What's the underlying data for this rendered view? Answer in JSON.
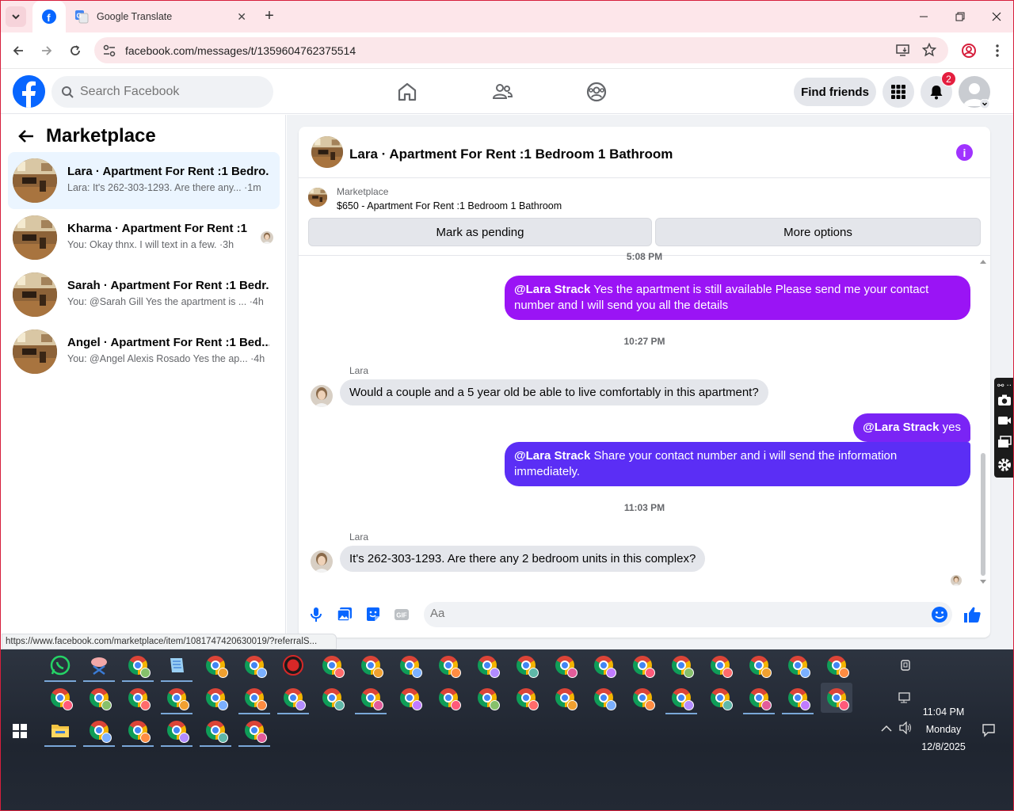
{
  "browser": {
    "tabs": [
      {
        "title": "",
        "icon": "facebook-icon",
        "active": true
      },
      {
        "title": "Google Translate",
        "icon": "google-translate-icon",
        "active": false
      }
    ],
    "url": "facebook.com/messages/t/1359604762375514",
    "status_url": "https://www.facebook.com/marketplace/item/1081747420630019/?referralS..."
  },
  "fb": {
    "search_placeholder": "Search Facebook",
    "find_friends": "Find friends",
    "notification_count": "2"
  },
  "sidebar": {
    "title": "Marketplace",
    "conversations": [
      {
        "name": "Lara · Apartment For Rent :1 Bedro...",
        "preview": "Lara: It's 262-303-1293. Are there any... ·1m",
        "selected": true
      },
      {
        "name": "Kharma · Apartment For Rent :1 ...",
        "preview": "You: Okay thnx. I will text in a few. ·3h",
        "selected": false
      },
      {
        "name": "Sarah · Apartment For Rent :1 Bedr...",
        "preview": "You: @Sarah Gill Yes the apartment is ... ·4h",
        "selected": false
      },
      {
        "name": "Angel · Apartment For Rent :1 Bed...",
        "preview": "You: @Angel Alexis Rosado Yes the ap... ·4h",
        "selected": false
      }
    ]
  },
  "chat": {
    "title": "Lara · Apartment For Rent :1 Bedroom 1 Bathroom",
    "marketplace_label": "Marketplace",
    "listing": "$650 - Apartment For Rent :1 Bedroom 1 Bathroom",
    "mark_pending": "Mark as pending",
    "more_options": "More options",
    "partial_time": "5:08 PM",
    "messages": [
      {
        "mention": "@Lara Strack",
        "text": " Yes the apartment is still available Please send me your contact number and I will send you all the details"
      },
      {
        "time": "10:27 PM"
      },
      {
        "sender": "Lara",
        "text": "Would a couple and a 5 year old be able to live comfortably in this apartment?"
      },
      {
        "mention": "@Lara Strack",
        "text": " yes"
      },
      {
        "mention": "@Lara Strack",
        "text": " Share your contact number and i will send the information immediately."
      },
      {
        "time": "11:03 PM"
      },
      {
        "sender": "Lara",
        "text": "It's 262-303-1293. Are there any 2 bedroom units in this complex?"
      }
    ],
    "composer_placeholder": "Aa",
    "colors": {
      "out_purple": "#9a14f5",
      "out_violet": "#7a24f5",
      "out_blue": "#5b2ef5",
      "accent": "#0866ff"
    }
  },
  "taskbar": {
    "time": "11:04 PM",
    "day": "Monday",
    "date": "12/8/2025"
  }
}
